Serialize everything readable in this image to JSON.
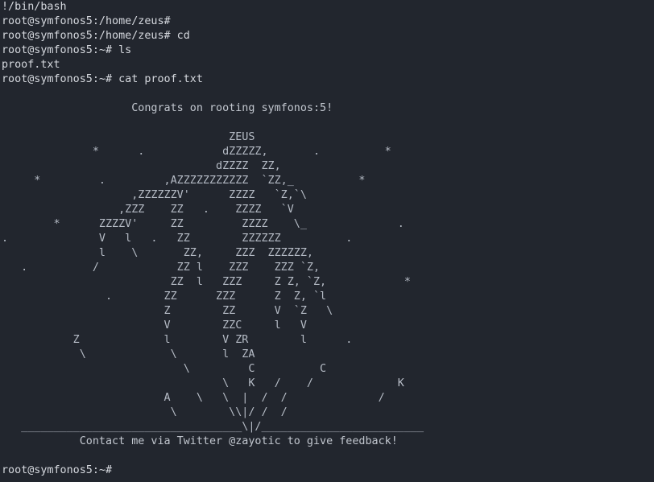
{
  "terminal": {
    "lines": [
      {
        "kind": "output",
        "text": "!/bin/bash"
      },
      {
        "kind": "prompt",
        "prompt": "root@symfonos5:/home/zeus#",
        "command": ""
      },
      {
        "kind": "prompt",
        "prompt": "root@symfonos5:/home/zeus#",
        "command": " cd"
      },
      {
        "kind": "prompt",
        "prompt": "root@symfonos5:~#",
        "command": " ls"
      },
      {
        "kind": "output",
        "text": "proof.txt"
      },
      {
        "kind": "prompt",
        "prompt": "root@symfonos5:~#",
        "command": " cat proof.txt"
      }
    ],
    "proof": {
      "congrats": "                    Congrats on rooting symfonos:5!",
      "art": [
        "",
        "                                   ZEUS",
        "              *      .            dZZZZZ,       .          *",
        "                                 dZZZZ  ZZ,",
        "     *         .         ,AZZZZZZZZZZZ  `ZZ,_          *",
        "                    ,ZZZZZZV'      ZZZZ   `Z,`\\",
        "                  ,ZZZ    ZZ   .    ZZZZ   `V",
        "        *      ZZZZV'     ZZ         ZZZZ    \\_              .",
        ".              V   l   .   ZZ        ZZZZZZ          .",
        "               l    \\       ZZ,     ZZZ  ZZZZZZ,",
        "   .          /            ZZ l    ZZZ    ZZZ `Z,",
        "                          ZZ  l   ZZZ     Z Z, `Z,            *",
        "                .        ZZ      ZZZ      Z  Z, `l",
        "                         Z        ZZ      V  `Z   \\",
        "                         V        ZZC     l   V",
        "           Z             l        V ZR        l      .",
        "            \\             \\       l  ZA",
        "                            \\         C          C",
        "                                  \\   K   /    /             K",
        "                         A    \\   \\  |  /  /              /",
        "                          \\        \\\\|/ /  /",
        "   __________________________________\\|/_________________________",
        "            Contact me via Twitter @zayotic to give feedback!"
      ]
    },
    "final_prompt": "root@symfonos5:~#"
  }
}
